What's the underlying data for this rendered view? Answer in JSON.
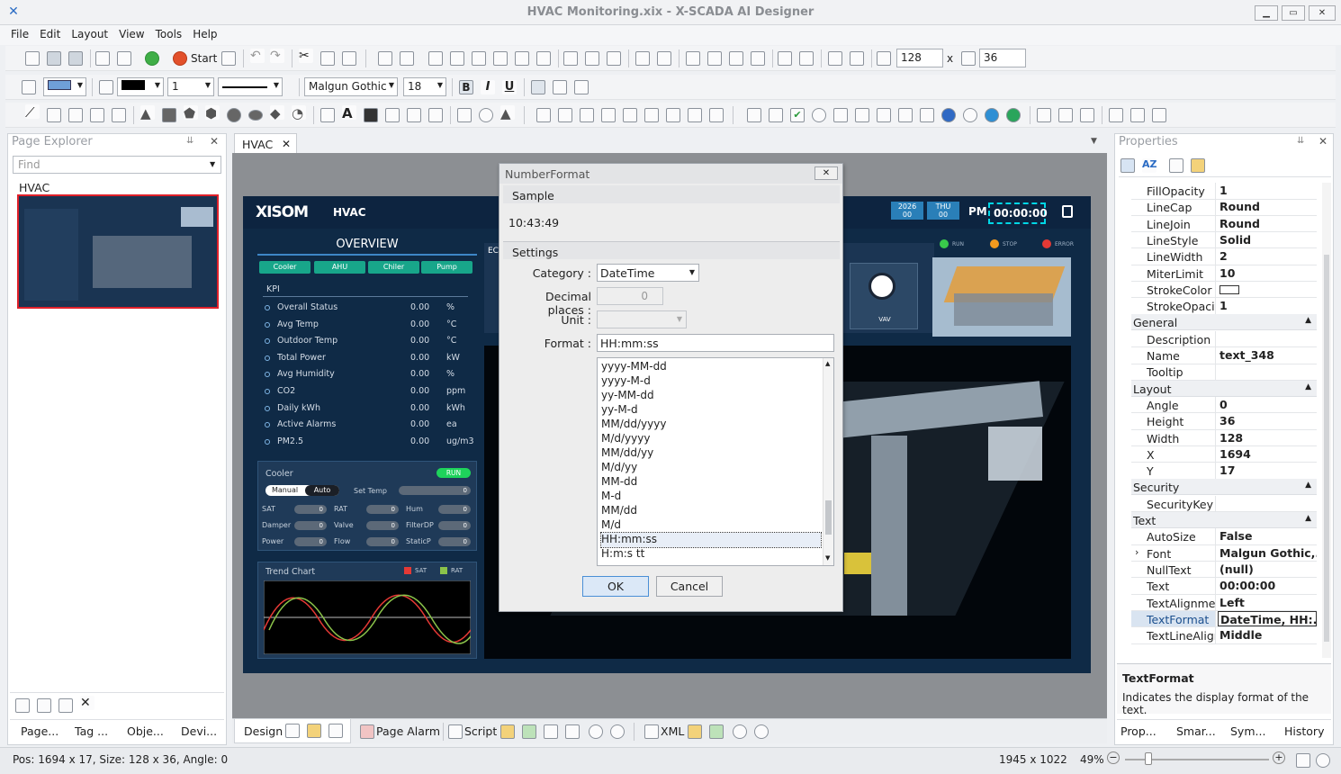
{
  "window": {
    "title": "HVAC Monitoring.xix - X-SCADA AI Designer",
    "min": "▁",
    "max": "▭",
    "close": "✕"
  },
  "menu": [
    "File",
    "Edit",
    "Layout",
    "View",
    "Tools",
    "Help"
  ],
  "toolbar": {
    "start_label": "Start",
    "width_value": "128",
    "height_value": "36",
    "times_sign": "x",
    "font_name": "Malgun Gothic",
    "font_size": "18",
    "line_width": "1",
    "bold": "B",
    "italic": "I",
    "underline": "U"
  },
  "page_explorer": {
    "title": "Page Explorer",
    "find_placeholder": "Find",
    "page_name": "HVAC",
    "pin": "⇊",
    "close": "✕",
    "bottom_tabs": [
      "Page...",
      "Tag ...",
      "Obje...",
      "Devi..."
    ]
  },
  "doc_tab": {
    "label": "HVAC",
    "close": "✕"
  },
  "scada": {
    "logo": "XISOM",
    "title": "HVAC",
    "overview": "OVERVIEW",
    "buttons": [
      "Cooler",
      "AHU",
      "Chiler",
      "Pump"
    ],
    "kpi_title": "KPI",
    "kpis": [
      {
        "n": "Overall Status",
        "v": "0.00",
        "u": "%"
      },
      {
        "n": "Avg Temp",
        "v": "0.00",
        "u": "°C"
      },
      {
        "n": "Outdoor Temp",
        "v": "0.00",
        "u": "°C"
      },
      {
        "n": "Total Power",
        "v": "0.00",
        "u": "kW"
      },
      {
        "n": "Avg Humidity",
        "v": "0.00",
        "u": "%"
      },
      {
        "n": "CO2",
        "v": "0.00",
        "u": "ppm"
      },
      {
        "n": "Daily kWh",
        "v": "0.00",
        "u": "kWh"
      },
      {
        "n": "Active Alarms",
        "v": "0.00",
        "u": "ea"
      },
      {
        "n": "PM2.5",
        "v": "0.00",
        "u": "ug/m3"
      }
    ],
    "year": "2026",
    "year_sub": "00",
    "day": "THU",
    "day_sub": "00",
    "time_prefix": "PM",
    "time": "00:00:00",
    "legend": [
      "RUN",
      "STOP",
      "ERROR"
    ],
    "vav": "VAV",
    "eq_label": "EC",
    "cooler": {
      "title": "Cooler",
      "status": "RUN",
      "manual": "Manual",
      "auto": "Auto",
      "set_temp": "Set Temp",
      "set_temp_value": "0",
      "fields": [
        [
          "SAT",
          "0"
        ],
        [
          "RAT",
          "0"
        ],
        [
          "Hum",
          "0"
        ],
        [
          "Damper",
          "0"
        ],
        [
          "Valve",
          "0"
        ],
        [
          "FilterDP",
          "0"
        ],
        [
          "Power",
          "0"
        ],
        [
          "Flow",
          "0"
        ],
        [
          "StaticP",
          "0"
        ]
      ]
    },
    "trend": {
      "title": "Trend Chart",
      "s1": "SAT",
      "s2": "RAT"
    }
  },
  "dialog": {
    "title": "NumberFormat",
    "close": "✕",
    "sample_hdr": "Sample",
    "sample": "10:43:49",
    "settings_hdr": "Settings",
    "category_label": "Category :",
    "category": "DateTime",
    "decimal_label": "Decimal places :",
    "decimal": "0",
    "unit_label": "Unit :",
    "format_label": "Format :",
    "format": "HH:mm:ss",
    "formats": [
      "yyyy-MM-dd",
      "yyyy-M-d",
      "yy-MM-dd",
      "yy-M-d",
      "MM/dd/yyyy",
      "M/d/yyyy",
      "MM/dd/yy",
      "M/d/yy",
      "MM-dd",
      "M-d",
      "MM/dd",
      "M/d",
      "HH:mm:ss",
      "H:m:s tt"
    ],
    "selected": "HH:mm:ss",
    "ok": "OK",
    "cancel": "Cancel"
  },
  "properties": {
    "title": "Properties",
    "pin": "⇊",
    "close": "✕",
    "rows1": [
      [
        "FillOpacity",
        "1"
      ],
      [
        "LineCap",
        "Round"
      ],
      [
        "LineJoin",
        "Round"
      ],
      [
        "LineStyle",
        "Solid"
      ],
      [
        "LineWidth",
        "2"
      ],
      [
        "MiterLimit",
        "10"
      ],
      [
        "StrokeColor",
        ""
      ],
      [
        "StrokeOpacity",
        "1"
      ]
    ],
    "cat_general": "General",
    "rows_general": [
      [
        "Description",
        ""
      ],
      [
        "Name",
        "text_348"
      ],
      [
        "Tooltip",
        ""
      ]
    ],
    "cat_layout": "Layout",
    "rows_layout": [
      [
        "Angle",
        "0"
      ],
      [
        "Height",
        "36"
      ],
      [
        "Width",
        "128"
      ],
      [
        "X",
        "1694"
      ],
      [
        "Y",
        "17"
      ]
    ],
    "cat_security": "Security",
    "rows_security": [
      [
        "SecurityKey",
        ""
      ]
    ],
    "cat_text": "Text",
    "rows_text": [
      [
        "AutoSize",
        "False"
      ],
      [
        "Font",
        "Malgun Gothic,..."
      ],
      [
        "NullText",
        "(null)"
      ],
      [
        "Text",
        "00:00:00"
      ],
      [
        "TextAlignmen",
        "Left"
      ],
      [
        "TextFormat",
        "DateTime, HH:..."
      ],
      [
        "TextLineAlign",
        "Middle"
      ]
    ],
    "desc_title": "TextFormat",
    "desc_text": "Indicates the display format of the text.",
    "bottom_tabs": [
      "Prop...",
      "Smar...",
      "Sym...",
      "History"
    ]
  },
  "bottom_tabs": {
    "design": "Design",
    "page_alarm": "Page Alarm",
    "script": "Script",
    "xml": "XML"
  },
  "status": {
    "pos": "Pos: 1694 x 17, Size: 128 x 36, Angle: 0",
    "resolution": "1945 x 1022",
    "zoom": "49%",
    "minus": "−",
    "plus": "+"
  }
}
